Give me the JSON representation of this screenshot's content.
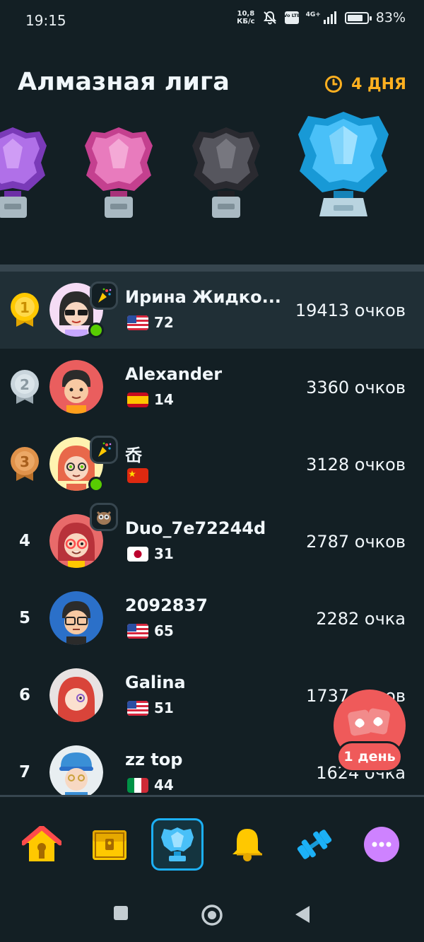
{
  "status": {
    "time": "19:15",
    "speed_value": "10,8",
    "speed_unit": "КБ/с",
    "network_label": "4G+",
    "volte_label": "Vo LTE",
    "battery_text": "83%",
    "battery_level": 0.83
  },
  "header": {
    "league_title": "Алмазная лига",
    "timer_label": "4 ДНЯ"
  },
  "leaderboard": [
    {
      "rank": "1",
      "name": "Ирина Жидко...",
      "country": "us",
      "streak": "72",
      "xp": "19413 очков",
      "highlight": true
    },
    {
      "rank": "2",
      "name": "Alexander",
      "country": "es",
      "streak": "14",
      "xp": "3360 очков"
    },
    {
      "rank": "3",
      "name": "岙",
      "country": "cn",
      "streak": "",
      "xp": "3128 очков"
    },
    {
      "rank": "4",
      "name": "Duo_7e72244d",
      "country": "jp",
      "streak": "31",
      "xp": "2787 очков"
    },
    {
      "rank": "5",
      "name": "2092837",
      "country": "us",
      "streak": "65",
      "xp": "2282 очка"
    },
    {
      "rank": "6",
      "name": "Galina",
      "country": "us",
      "streak": "51",
      "xp": "1737 очков"
    },
    {
      "rank": "7",
      "name": "zz top",
      "country": "it",
      "streak": "44",
      "xp": "1624 очка"
    }
  ],
  "floating_badge": {
    "label": "1 день"
  },
  "tabs": [
    {
      "name": "home",
      "icon": "house-icon"
    },
    {
      "name": "chest",
      "icon": "chest-icon"
    },
    {
      "name": "leagues",
      "icon": "trophy-icon",
      "active": true
    },
    {
      "name": "notifications",
      "icon": "bell-icon"
    },
    {
      "name": "practice",
      "icon": "dumbbell-icon"
    },
    {
      "name": "more",
      "icon": "more-icon"
    }
  ],
  "colors": {
    "background": "#131f24",
    "highlight_row": "#202f36",
    "accent_blue": "#1cb0f6",
    "timer_orange": "#ffb020",
    "online_green": "#58cc02",
    "floater_red": "#ef5a5a"
  }
}
